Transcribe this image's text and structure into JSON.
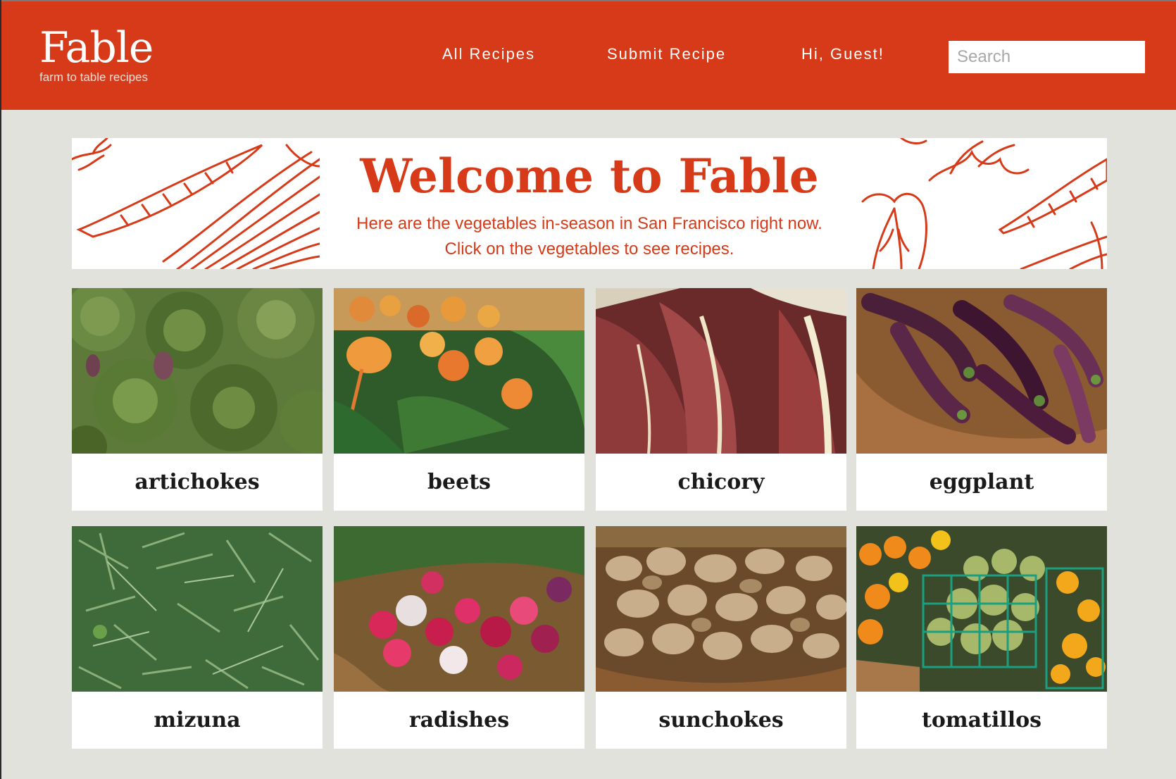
{
  "header": {
    "logo_title": "Fable",
    "logo_subtitle": "farm to table recipes",
    "nav": {
      "all_recipes": "All Recipes",
      "submit_recipe": "Submit Recipe",
      "greeting": "Hi, Guest!"
    },
    "search_placeholder": "Search",
    "search_value": ""
  },
  "banner": {
    "title": "Welcome to Fable",
    "line1": "Here are the vegetables in-season in San Francisco right now.",
    "line2": "Click on the vegetables to see recipes."
  },
  "vegetables": [
    {
      "label": "artichokes"
    },
    {
      "label": "beets"
    },
    {
      "label": "chicory"
    },
    {
      "label": "eggplant"
    },
    {
      "label": "mizuna"
    },
    {
      "label": "radishes"
    },
    {
      "label": "sunchokes"
    },
    {
      "label": "tomatillos"
    }
  ],
  "colors": {
    "brand_red": "#d63a18",
    "page_background": "#e2e2dc",
    "card_background": "#ffffff"
  }
}
